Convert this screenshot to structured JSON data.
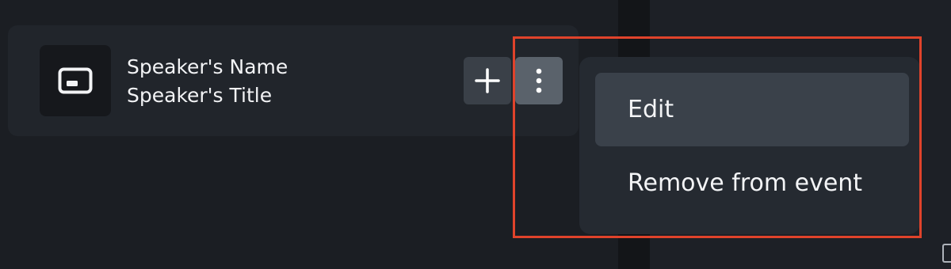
{
  "speaker": {
    "name": "Speaker's Name",
    "title": "Speaker's Title",
    "avatar_icon": "id-card-icon"
  },
  "actions": {
    "add_icon": "plus-icon",
    "more_icon": "vertical-ellipsis-icon"
  },
  "menu": {
    "items": [
      {
        "label": "Edit",
        "active": true
      },
      {
        "label": "Remove from event",
        "active": false
      }
    ]
  },
  "highlight": {
    "color": "#e0432b"
  }
}
